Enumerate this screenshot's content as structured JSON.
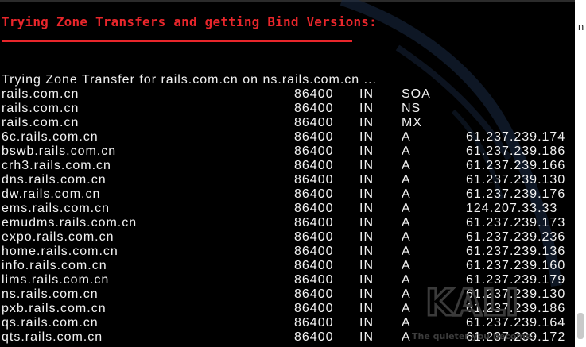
{
  "heading": "Trying Zone Transfers and getting Bind Versions:",
  "intro": "Trying Zone Transfer for rails.com.cn on ns.rails.com.cn ...",
  "records": [
    {
      "name": "rails.com.cn",
      "ttl": "86400",
      "class": "IN",
      "type": "SOA",
      "value": ""
    },
    {
      "name": "rails.com.cn",
      "ttl": "86400",
      "class": "IN",
      "type": "NS",
      "value": ""
    },
    {
      "name": "rails.com.cn",
      "ttl": "86400",
      "class": "IN",
      "type": "MX",
      "value": ""
    },
    {
      "name": "6c.rails.com.cn",
      "ttl": "86400",
      "class": "IN",
      "type": "A",
      "value": "61.237.239.174"
    },
    {
      "name": "bswb.rails.com.cn",
      "ttl": "86400",
      "class": "IN",
      "type": "A",
      "value": "61.237.239.186"
    },
    {
      "name": "crh3.rails.com.cn",
      "ttl": "86400",
      "class": "IN",
      "type": "A",
      "value": "61.237.239.166"
    },
    {
      "name": "dns.rails.com.cn",
      "ttl": "86400",
      "class": "IN",
      "type": "A",
      "value": "61.237.239.130"
    },
    {
      "name": "dw.rails.com.cn",
      "ttl": "86400",
      "class": "IN",
      "type": "A",
      "value": "61.237.239.176"
    },
    {
      "name": "ems.rails.com.cn",
      "ttl": "86400",
      "class": "IN",
      "type": "A",
      "value": "124.207.33.33"
    },
    {
      "name": "emudms.rails.com.cn",
      "ttl": "86400",
      "class": "IN",
      "type": "A",
      "value": "61.237.239.173"
    },
    {
      "name": "expo.rails.com.cn",
      "ttl": "86400",
      "class": "IN",
      "type": "A",
      "value": "61.237.239.236"
    },
    {
      "name": "home.rails.com.cn",
      "ttl": "86400",
      "class": "IN",
      "type": "A",
      "value": "61.237.239.136"
    },
    {
      "name": "info.rails.com.cn",
      "ttl": "86400",
      "class": "IN",
      "type": "A",
      "value": "61.237.239.160"
    },
    {
      "name": "lims.rails.com.cn",
      "ttl": "86400",
      "class": "IN",
      "type": "A",
      "value": "61.237.239.179"
    },
    {
      "name": "ns.rails.com.cn",
      "ttl": "86400",
      "class": "IN",
      "type": "A",
      "value": "61.237.239.130"
    },
    {
      "name": "pxb.rails.com.cn",
      "ttl": "86400",
      "class": "IN",
      "type": "A",
      "value": "61.237.239.186"
    },
    {
      "name": "qs.rails.com.cn",
      "ttl": "86400",
      "class": "IN",
      "type": "A",
      "value": "61.237.239.164"
    },
    {
      "name": "qts.rails.com.cn",
      "ttl": "86400",
      "class": "IN",
      "type": "A",
      "value": "61.237.239.172"
    }
  ],
  "watermark": {
    "logo": "KALI",
    "tagline": "The quieter you become"
  },
  "side_fragment": "n",
  "colors": {
    "background": "#000000",
    "text": "#f2f2f2",
    "heading": "#e8262b",
    "watermark": "#3a3a3a"
  },
  "icons": {
    "watermark": "kali-dragon-watermark-icon"
  }
}
